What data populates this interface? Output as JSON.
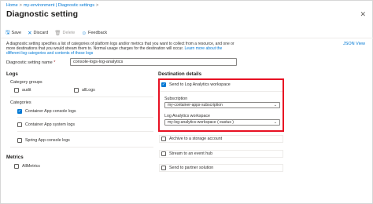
{
  "breadcrumb": {
    "home": "Home",
    "sep": ">",
    "env": "my-environment | Diagnostic settings",
    "sep2": ">"
  },
  "page": {
    "title": "Diagnostic setting",
    "close_glyph": "✕"
  },
  "toolbar": {
    "save": {
      "label": "Save",
      "icon": "save-icon",
      "glyph": "🖫"
    },
    "discard": {
      "label": "Discard",
      "icon": "close-icon",
      "glyph": "✕"
    },
    "delete": {
      "label": "Delete",
      "icon": "trash-icon",
      "glyph": "🗑"
    },
    "feedback": {
      "label": "Feedback",
      "icon": "feedback-icon",
      "glyph": "☺"
    }
  },
  "json_view": "JSON View",
  "description": {
    "text": "A diagnostic setting specifies a list of categories of platform logs and/or metrics that you want to collect from a resource, and one or more destinations that you would stream them to. Normal usage charges for the destination will occur.",
    "link": "Learn more about the different log categories and contents of those logs"
  },
  "name_field": {
    "label": "Diagnostic setting name",
    "required": "*",
    "value": "console-logs-log-analytics"
  },
  "logs": {
    "title": "Logs",
    "category_groups_label": "Category groups",
    "groups": [
      {
        "label": "audit",
        "checked": false
      },
      {
        "label": "allLogs",
        "checked": false
      }
    ],
    "categories_label": "Categories",
    "categories": [
      {
        "label": "Container App console logs",
        "checked": true
      },
      {
        "label": "Container App system logs",
        "checked": false
      },
      {
        "label": "Spring App console logs",
        "checked": false
      }
    ]
  },
  "metrics": {
    "title": "Metrics",
    "items": [
      {
        "label": "AllMetrics",
        "checked": false
      }
    ]
  },
  "destination": {
    "title": "Destination details",
    "log_analytics": {
      "label": "Send to Log Analytics workspace",
      "checked": true
    },
    "subscription": {
      "label": "Subscription",
      "value": "my-container-apps-subscription"
    },
    "workspace": {
      "label": "Log Analytics workspace",
      "value": "my-log-analytics-workspace ( eastus )"
    },
    "others": [
      {
        "label": "Archive to a storage account",
        "checked": false
      },
      {
        "label": "Stream to an event hub",
        "checked": false
      },
      {
        "label": "Send to partner solution",
        "checked": false
      }
    ]
  },
  "colors": {
    "accent": "#0078d4",
    "highlight_border": "#e81123",
    "text": "#323130"
  },
  "check_glyph": "✓",
  "chevron_glyph": "⌄"
}
